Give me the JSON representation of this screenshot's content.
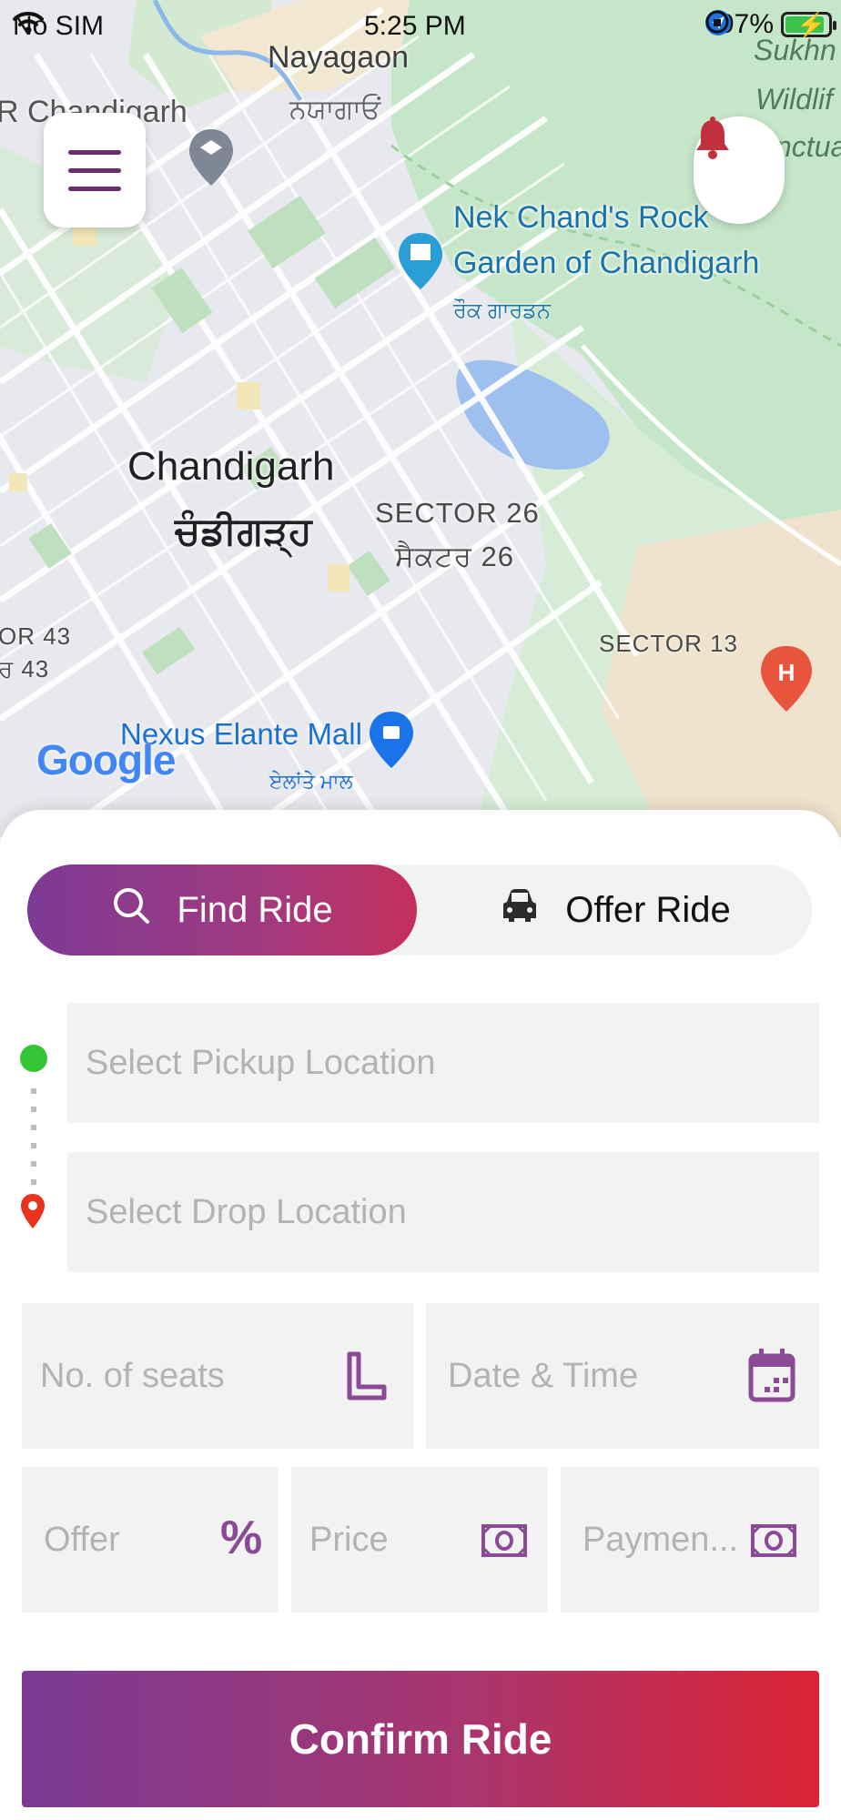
{
  "status_bar": {
    "carrier": "No SIM",
    "time": "5:25 PM",
    "battery": "97%"
  },
  "map": {
    "labels": {
      "nayagaon": "Nayagaon",
      "nayagaon_pa": "ਨਯਾਗਾਓਂ",
      "r_chandigarh": "R Chandigarh",
      "chandigarh": "Chandigarh",
      "chandigarh_pa": "ਚੰਡੀਗੜ੍ਹ",
      "sector26": "SECTOR 26",
      "sector26_pa": "ਸੈਕਟਰ 26",
      "sector13": "SECTOR 13",
      "sector43": "OR 43",
      "sector43_pa": "ਰ 43",
      "rock_garden_1": "Nek Chand's Rock",
      "rock_garden_2": "Garden of Chandigarh",
      "rock_garden_pa": "ਰੌਕ ਗਾਰਡਨ",
      "nexus_mall": "Nexus Elante Mall",
      "nexus_mall_pa": "ਏਲਾਂਤੇ ਮਾਲ",
      "sukhna_1": "Sukhn",
      "sukhna_2": "Wildlif",
      "sukhna_3": "nctua",
      "google": "Google"
    }
  },
  "tabs": {
    "find": "Find Ride",
    "offer": "Offer Ride"
  },
  "form": {
    "pickup_placeholder": "Select Pickup Location",
    "drop_placeholder": "Select Drop Location",
    "seats_placeholder": "No. of seats",
    "datetime_placeholder": "Date & Time",
    "offer_placeholder": "Offer",
    "price_placeholder": "Price",
    "payment_placeholder": "Paymen..."
  },
  "confirm_label": "Confirm Ride",
  "colors": {
    "accent_purple": "#7d3a94",
    "accent_red": "#dc2434",
    "icon_purple": "#8a4a96",
    "pickup_green": "#33c533",
    "drop_red": "#e8341c"
  }
}
